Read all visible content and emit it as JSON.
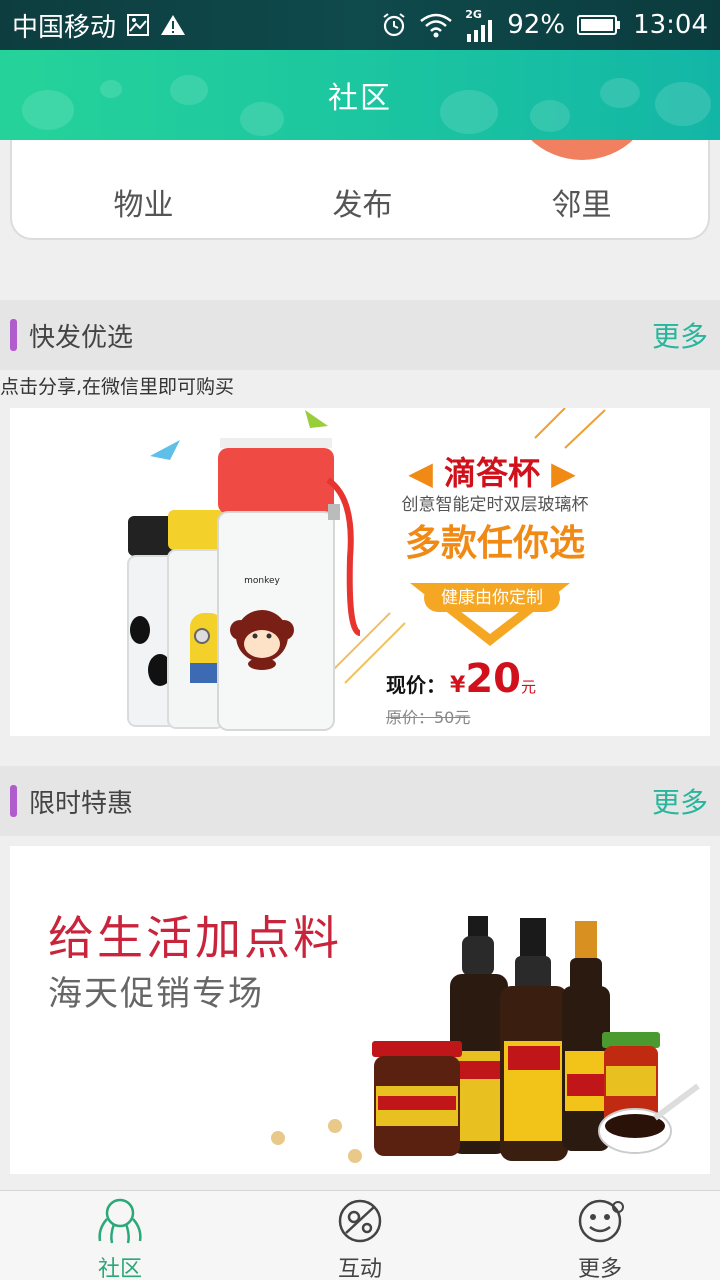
{
  "status_bar": {
    "carrier": "中国移动",
    "network": "2G",
    "battery": "92%",
    "time": "13:04"
  },
  "header": {
    "title": "社区"
  },
  "categories": [
    {
      "label": "物业",
      "color": "#3fb6e8"
    },
    {
      "label": "发布",
      "color": "#5cbf6a"
    },
    {
      "label": "邻里",
      "color": "#f08060"
    }
  ],
  "sections": {
    "quick": {
      "title": "快发优选",
      "more": "更多",
      "hint": "点击分享,在微信里即可购买"
    },
    "sale": {
      "title": "限时特惠",
      "more": "更多"
    }
  },
  "banner_cup": {
    "name": "滴答杯",
    "subtitle": "创意智能定时双层玻璃杯",
    "slogan": "多款任你选",
    "tag": "健康由你定制",
    "price_label": "现价：",
    "price_symbol": "¥",
    "price": "20",
    "price_unit": "元",
    "original_price": "原价：50元",
    "cup_text": "monkey"
  },
  "banner_sauce": {
    "headline": "给生活加点料",
    "subline": "海天促销专场"
  },
  "bottom_nav": [
    {
      "label": "社区",
      "icon": "community-icon",
      "active": true
    },
    {
      "label": "互动",
      "icon": "interact-icon",
      "active": false
    },
    {
      "label": "更多",
      "icon": "smile-icon",
      "active": false
    }
  ],
  "colors": {
    "accent": "#1cc6a0",
    "section_bar": "#b05ccd",
    "more_link": "#27b59c",
    "price_red": "#d0101a",
    "slogan_orange": "#f08a14",
    "headline_red": "#c8243c"
  }
}
